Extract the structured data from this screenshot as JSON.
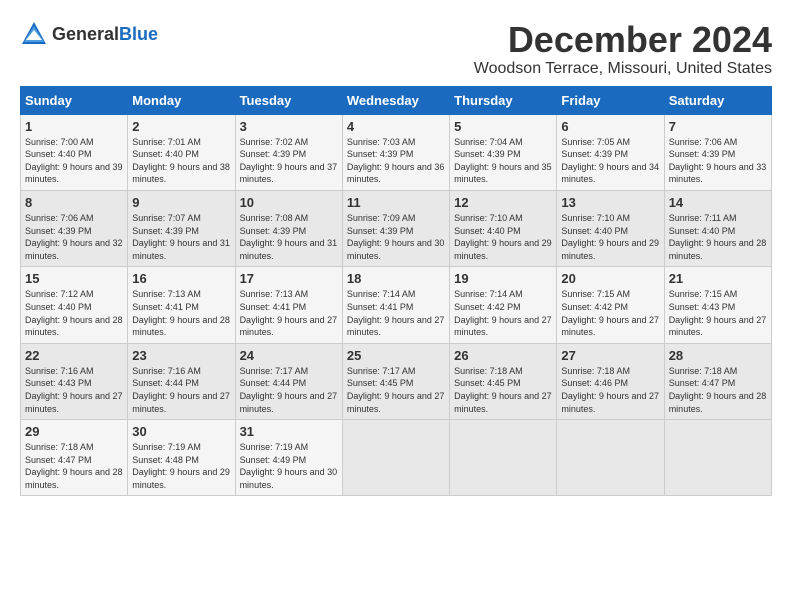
{
  "header": {
    "logo_general": "General",
    "logo_blue": "Blue",
    "month": "December 2024",
    "location": "Woodson Terrace, Missouri, United States"
  },
  "weekdays": [
    "Sunday",
    "Monday",
    "Tuesday",
    "Wednesday",
    "Thursday",
    "Friday",
    "Saturday"
  ],
  "weeks": [
    [
      {
        "day": "1",
        "sunrise": "7:00 AM",
        "sunset": "4:40 PM",
        "daylight": "9 hours and 39 minutes."
      },
      {
        "day": "2",
        "sunrise": "7:01 AM",
        "sunset": "4:40 PM",
        "daylight": "9 hours and 38 minutes."
      },
      {
        "day": "3",
        "sunrise": "7:02 AM",
        "sunset": "4:39 PM",
        "daylight": "9 hours and 37 minutes."
      },
      {
        "day": "4",
        "sunrise": "7:03 AM",
        "sunset": "4:39 PM",
        "daylight": "9 hours and 36 minutes."
      },
      {
        "day": "5",
        "sunrise": "7:04 AM",
        "sunset": "4:39 PM",
        "daylight": "9 hours and 35 minutes."
      },
      {
        "day": "6",
        "sunrise": "7:05 AM",
        "sunset": "4:39 PM",
        "daylight": "9 hours and 34 minutes."
      },
      {
        "day": "7",
        "sunrise": "7:06 AM",
        "sunset": "4:39 PM",
        "daylight": "9 hours and 33 minutes."
      }
    ],
    [
      {
        "day": "8",
        "sunrise": "7:06 AM",
        "sunset": "4:39 PM",
        "daylight": "9 hours and 32 minutes."
      },
      {
        "day": "9",
        "sunrise": "7:07 AM",
        "sunset": "4:39 PM",
        "daylight": "9 hours and 31 minutes."
      },
      {
        "day": "10",
        "sunrise": "7:08 AM",
        "sunset": "4:39 PM",
        "daylight": "9 hours and 31 minutes."
      },
      {
        "day": "11",
        "sunrise": "7:09 AM",
        "sunset": "4:39 PM",
        "daylight": "9 hours and 30 minutes."
      },
      {
        "day": "12",
        "sunrise": "7:10 AM",
        "sunset": "4:40 PM",
        "daylight": "9 hours and 29 minutes."
      },
      {
        "day": "13",
        "sunrise": "7:10 AM",
        "sunset": "4:40 PM",
        "daylight": "9 hours and 29 minutes."
      },
      {
        "day": "14",
        "sunrise": "7:11 AM",
        "sunset": "4:40 PM",
        "daylight": "9 hours and 28 minutes."
      }
    ],
    [
      {
        "day": "15",
        "sunrise": "7:12 AM",
        "sunset": "4:40 PM",
        "daylight": "9 hours and 28 minutes."
      },
      {
        "day": "16",
        "sunrise": "7:13 AM",
        "sunset": "4:41 PM",
        "daylight": "9 hours and 28 minutes."
      },
      {
        "day": "17",
        "sunrise": "7:13 AM",
        "sunset": "4:41 PM",
        "daylight": "9 hours and 27 minutes."
      },
      {
        "day": "18",
        "sunrise": "7:14 AM",
        "sunset": "4:41 PM",
        "daylight": "9 hours and 27 minutes."
      },
      {
        "day": "19",
        "sunrise": "7:14 AM",
        "sunset": "4:42 PM",
        "daylight": "9 hours and 27 minutes."
      },
      {
        "day": "20",
        "sunrise": "7:15 AM",
        "sunset": "4:42 PM",
        "daylight": "9 hours and 27 minutes."
      },
      {
        "day": "21",
        "sunrise": "7:15 AM",
        "sunset": "4:43 PM",
        "daylight": "9 hours and 27 minutes."
      }
    ],
    [
      {
        "day": "22",
        "sunrise": "7:16 AM",
        "sunset": "4:43 PM",
        "daylight": "9 hours and 27 minutes."
      },
      {
        "day": "23",
        "sunrise": "7:16 AM",
        "sunset": "4:44 PM",
        "daylight": "9 hours and 27 minutes."
      },
      {
        "day": "24",
        "sunrise": "7:17 AM",
        "sunset": "4:44 PM",
        "daylight": "9 hours and 27 minutes."
      },
      {
        "day": "25",
        "sunrise": "7:17 AM",
        "sunset": "4:45 PM",
        "daylight": "9 hours and 27 minutes."
      },
      {
        "day": "26",
        "sunrise": "7:18 AM",
        "sunset": "4:45 PM",
        "daylight": "9 hours and 27 minutes."
      },
      {
        "day": "27",
        "sunrise": "7:18 AM",
        "sunset": "4:46 PM",
        "daylight": "9 hours and 27 minutes."
      },
      {
        "day": "28",
        "sunrise": "7:18 AM",
        "sunset": "4:47 PM",
        "daylight": "9 hours and 28 minutes."
      }
    ],
    [
      {
        "day": "29",
        "sunrise": "7:18 AM",
        "sunset": "4:47 PM",
        "daylight": "9 hours and 28 minutes."
      },
      {
        "day": "30",
        "sunrise": "7:19 AM",
        "sunset": "4:48 PM",
        "daylight": "9 hours and 29 minutes."
      },
      {
        "day": "31",
        "sunrise": "7:19 AM",
        "sunset": "4:49 PM",
        "daylight": "9 hours and 30 minutes."
      },
      null,
      null,
      null,
      null
    ]
  ],
  "labels": {
    "sunrise": "Sunrise:",
    "sunset": "Sunset:",
    "daylight": "Daylight:"
  }
}
